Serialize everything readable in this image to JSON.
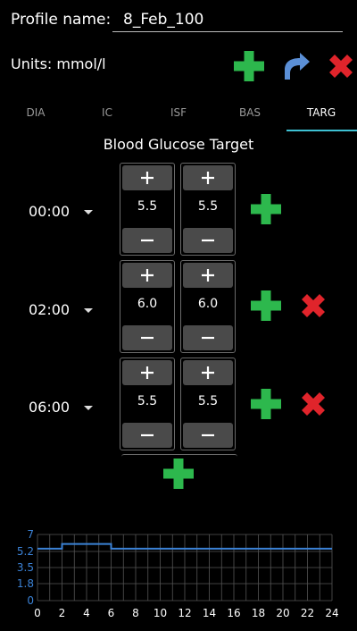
{
  "profile": {
    "label": "Profile name:",
    "value": "8_Feb_100"
  },
  "units_label": "Units: mmol/l",
  "toolbar": {
    "add_icon": "plus-icon",
    "redo_icon": "redo-arrow-icon",
    "close_icon": "close-x-icon",
    "colors": {
      "green": "#2db84d",
      "blue": "#5b8fd6",
      "red": "#e0242b"
    }
  },
  "tabs": [
    {
      "label": "DIA",
      "active": false
    },
    {
      "label": "IC",
      "active": false
    },
    {
      "label": "ISF",
      "active": false
    },
    {
      "label": "BAS",
      "active": false
    },
    {
      "label": "TARG",
      "active": true
    }
  ],
  "section_title": "Blood Glucose Target",
  "rows": [
    {
      "time": "00:00",
      "low": "5.5",
      "high": "5.5",
      "removable": false
    },
    {
      "time": "02:00",
      "low": "6.0",
      "high": "6.0",
      "removable": true
    },
    {
      "time": "06:00",
      "low": "5.5",
      "high": "5.5",
      "removable": true
    }
  ],
  "chart_data": {
    "type": "line",
    "x": [
      0,
      2,
      2,
      6,
      6,
      24
    ],
    "series": [
      {
        "values": [
          5.5,
          5.5,
          6.0,
          6.0,
          5.5,
          5.5
        ]
      }
    ],
    "xlim": [
      0,
      24
    ],
    "ylim": [
      0,
      7
    ],
    "xticks": [
      "0",
      "2",
      "4",
      "6",
      "8",
      "10",
      "12",
      "14",
      "16",
      "18",
      "20",
      "22",
      "24"
    ],
    "yticks": [
      "0",
      "1.8",
      "3.5",
      "5.2",
      "7"
    ],
    "grid": true,
    "line_color": "#3b82d6"
  }
}
